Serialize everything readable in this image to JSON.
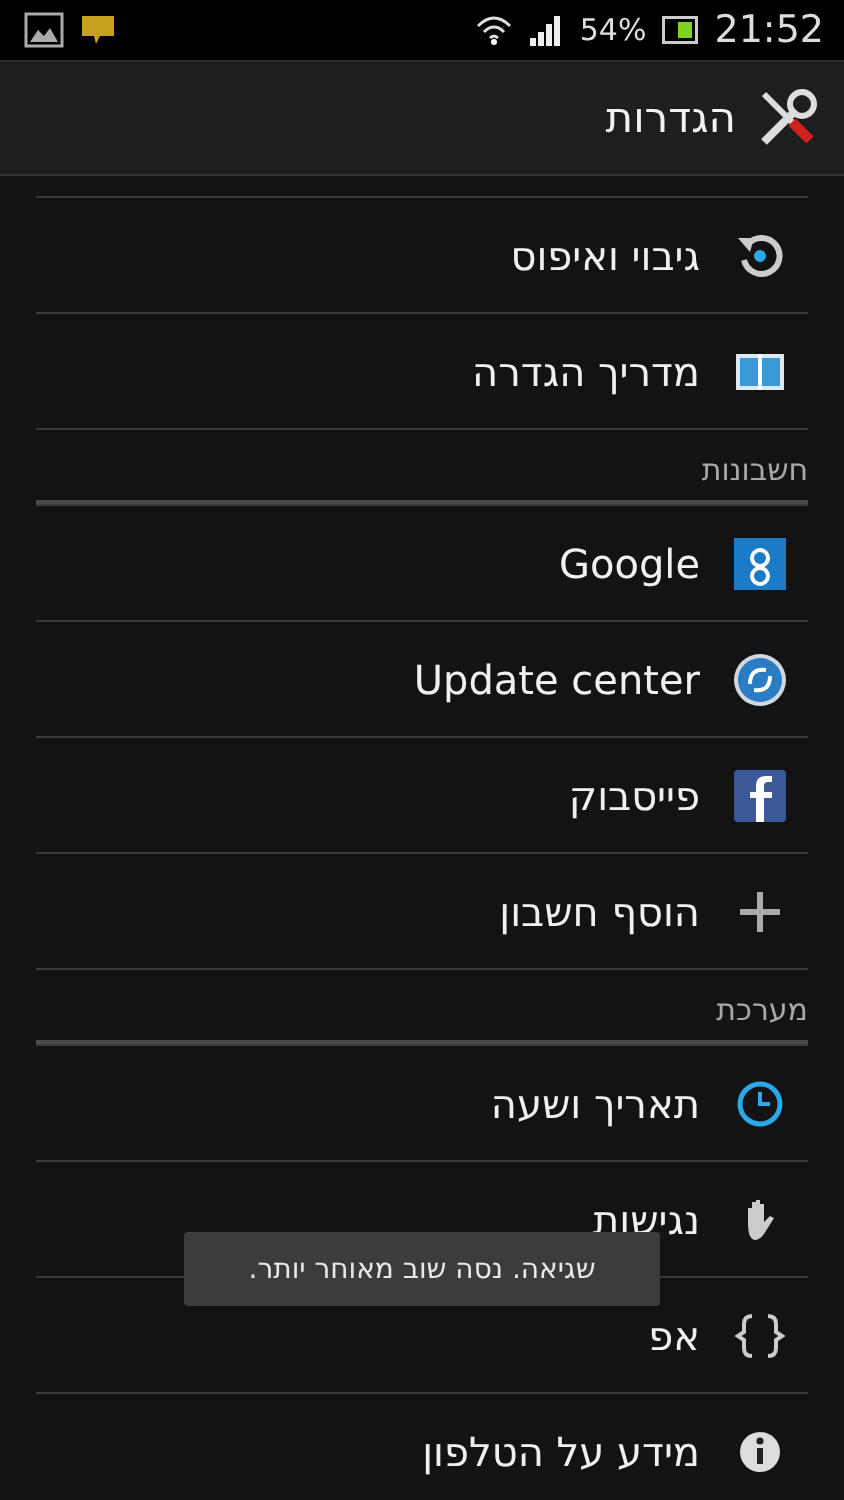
{
  "status_bar": {
    "battery": "54%",
    "time": "21:52"
  },
  "action_bar": {
    "title": "הגדרות"
  },
  "rows": [
    {
      "kind": "item",
      "label": "גיבוי ואיפוס"
    },
    {
      "kind": "item",
      "label": "מדריך הגדרה"
    },
    {
      "kind": "header",
      "label": "חשבונות"
    },
    {
      "kind": "item",
      "label": "Google"
    },
    {
      "kind": "item",
      "label": "Update center"
    },
    {
      "kind": "item",
      "label": "פייסבוק"
    },
    {
      "kind": "item",
      "label": "הוסף חשבון"
    },
    {
      "kind": "header",
      "label": "מערכת"
    },
    {
      "kind": "item",
      "label": "תאריך ושעה"
    },
    {
      "kind": "item",
      "label": "נגישות"
    },
    {
      "kind": "item",
      "label": "אפ"
    },
    {
      "kind": "item",
      "label": "מידע על הטלפון"
    }
  ],
  "toast": {
    "message": "שגיאה. נסה שוב מאוחר יותר."
  }
}
